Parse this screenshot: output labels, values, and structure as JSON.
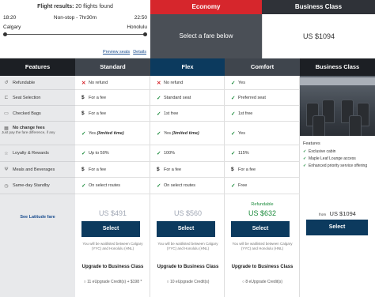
{
  "flight": {
    "title_prefix": "Flight results:",
    "title_count": "20 flights found",
    "depart_time": "18:20",
    "stops": "Non-stop - 7hr30m",
    "arrive_time": "22:50",
    "origin": "Calgary",
    "destination": "Honolulu",
    "preview_seats": "Preview seats",
    "details": "Details"
  },
  "cabins": {
    "economy_label": "Economy",
    "economy_prompt": "Select a fare below",
    "business_label": "Business Class",
    "business_price": "US $1094"
  },
  "columns": {
    "features": "Features",
    "standard": "Standard",
    "flex": "Flex",
    "comfort": "Comfort",
    "business": "Business Class"
  },
  "colors": {
    "features_header": "#1c1f24",
    "standard_header": "#3f454d",
    "flex_header": "#0c3a5e",
    "comfort_header": "#3f454d",
    "business_header": "#1c1f24",
    "accent_red": "#d6262c",
    "check_green": "#1a8a3a",
    "button_navy": "#0c3a5e"
  },
  "features": [
    {
      "icon": "refund-icon",
      "label": "Refundable"
    },
    {
      "icon": "seat-icon",
      "label": "Seat Selection"
    },
    {
      "icon": "bag-icon",
      "label": "Checked Bags"
    },
    {
      "icon": "calendar-icon",
      "label": "No change fees",
      "sub": "Just pay the fare difference, if any"
    },
    {
      "icon": "star-icon",
      "label": "Loyalty & Rewards"
    },
    {
      "icon": "meal-icon",
      "label": "Meals and Beverages"
    },
    {
      "icon": "clock-icon",
      "label": "Same-day Standby"
    }
  ],
  "see_latitude": "See Latitude fare",
  "standard": {
    "cells": [
      {
        "mark": "x",
        "text": "No refund"
      },
      {
        "mark": "$",
        "text": "For a fee"
      },
      {
        "mark": "$",
        "text": "For a fee"
      },
      {
        "mark": "check",
        "text": "Yes ",
        "em": "(limited time)"
      },
      {
        "mark": "check",
        "text": "Up to 50%"
      },
      {
        "mark": "$",
        "text": "For a fee"
      },
      {
        "mark": "check",
        "text": "On select routes"
      }
    ],
    "price": "US $491",
    "select": "Select",
    "waitlist": "You will be waitlisted between Calgary (YYC) and Honolulu (HNL)",
    "upgrade": "Upgrade to Business Class",
    "credit": "11 eUpgrade Credit(s) + $198 *"
  },
  "flex": {
    "cells": [
      {
        "mark": "x",
        "text": "No refund"
      },
      {
        "mark": "check",
        "text": "Standard seat"
      },
      {
        "mark": "check",
        "text": "1st free"
      },
      {
        "mark": "check",
        "text": "Yes ",
        "em": "(limited time)"
      },
      {
        "mark": "check",
        "text": "100%"
      },
      {
        "mark": "$",
        "text": "For a fee"
      },
      {
        "mark": "check",
        "text": "On select routes"
      }
    ],
    "price": "US $560",
    "select": "Select",
    "waitlist": "You will be waitlisted between Calgary (YYC) and Honolulu (HNL)",
    "upgrade": "Upgrade to Business Class",
    "credit": "10 eUpgrade Credit(s)"
  },
  "comfort": {
    "cells": [
      {
        "mark": "check",
        "text": "Yes"
      },
      {
        "mark": "check",
        "text": "Preferred seat"
      },
      {
        "mark": "check",
        "text": "1st free"
      },
      {
        "mark": "check",
        "text": "Yes"
      },
      {
        "mark": "check",
        "text": "115%"
      },
      {
        "mark": "$",
        "text": "For a fee"
      },
      {
        "mark": "check",
        "text": "Free"
      }
    ],
    "refundable": "Refundable",
    "price": "US $632",
    "select": "Select",
    "waitlist": "You will be waitlisted between Calgary (YYC) and Honolulu (HNL)",
    "upgrade": "Upgrade to Business Class",
    "credit": "8 eUpgrade Credit(s)"
  },
  "business": {
    "features_title": "Features",
    "features": [
      "Exclusive cabin",
      "Maple Leaf Lounge access",
      "Enhanced priority service offering"
    ],
    "from": "from",
    "price": "US $1094",
    "select": "Select"
  }
}
